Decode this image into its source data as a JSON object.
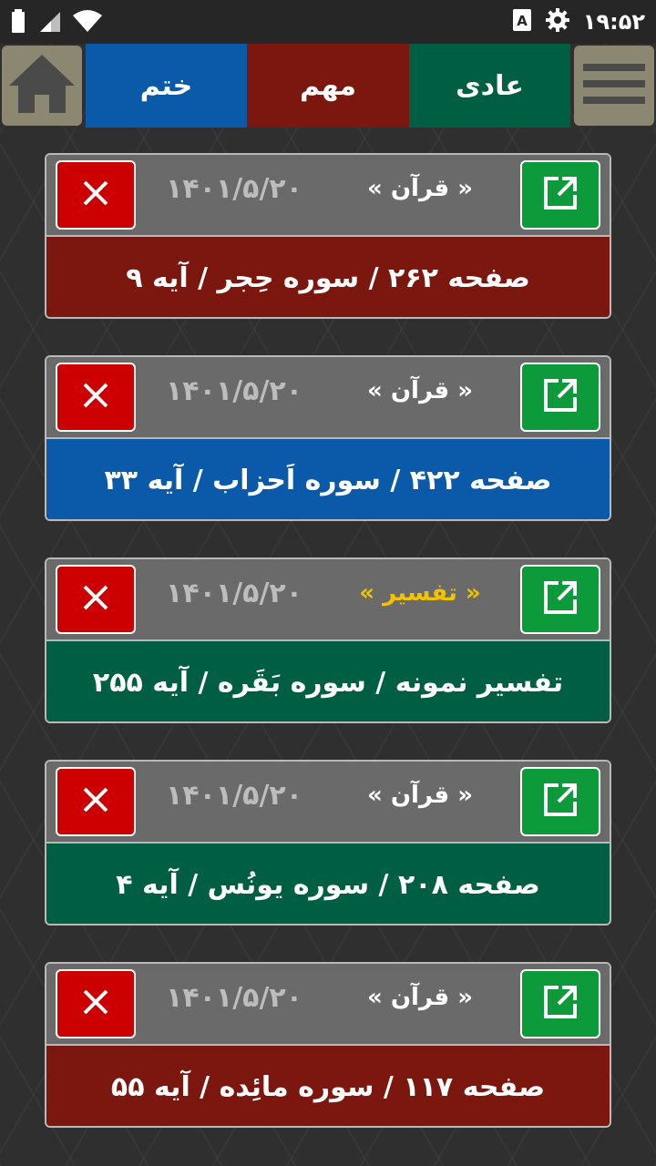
{
  "status": {
    "time": "۱۹:۵۲"
  },
  "tabs": {
    "khatm": "ختم",
    "mohem": "مهم",
    "adi": "عادی"
  },
  "colors": {
    "adi": "#005f43",
    "mohem": "#7b170e",
    "khatm": "#0b5aaa"
  },
  "items": [
    {
      "date": "۱۴۰۱/۵/۲۰",
      "category": "« قرآن »",
      "text": "صفحه ۲۶۲ / سوره حِجر / آیه ۹",
      "color": "#7b170e"
    },
    {
      "date": "۱۴۰۱/۵/۲۰",
      "category": "« قرآن »",
      "text": "صفحه ۴۲۲ / سوره اَحزاب / آیه ۳۳",
      "color": "#0b5aaa"
    },
    {
      "date": "۱۴۰۱/۵/۲۰",
      "category": "« تفسیر »",
      "text": "تفسیر نمونه / سوره بَقَره / آیه ۲۵۵",
      "color": "#005f43"
    },
    {
      "date": "۱۴۰۱/۵/۲۰",
      "category": "« قرآن »",
      "text": "صفحه ۲۰۸ / سوره یونُس / آیه ۴",
      "color": "#005f43"
    },
    {
      "date": "۱۴۰۱/۵/۲۰",
      "category": "« قرآن »",
      "text": "صفحه ۱۱۷ / سوره مائِده / آیه ۵۵",
      "color": "#7b170e"
    }
  ]
}
